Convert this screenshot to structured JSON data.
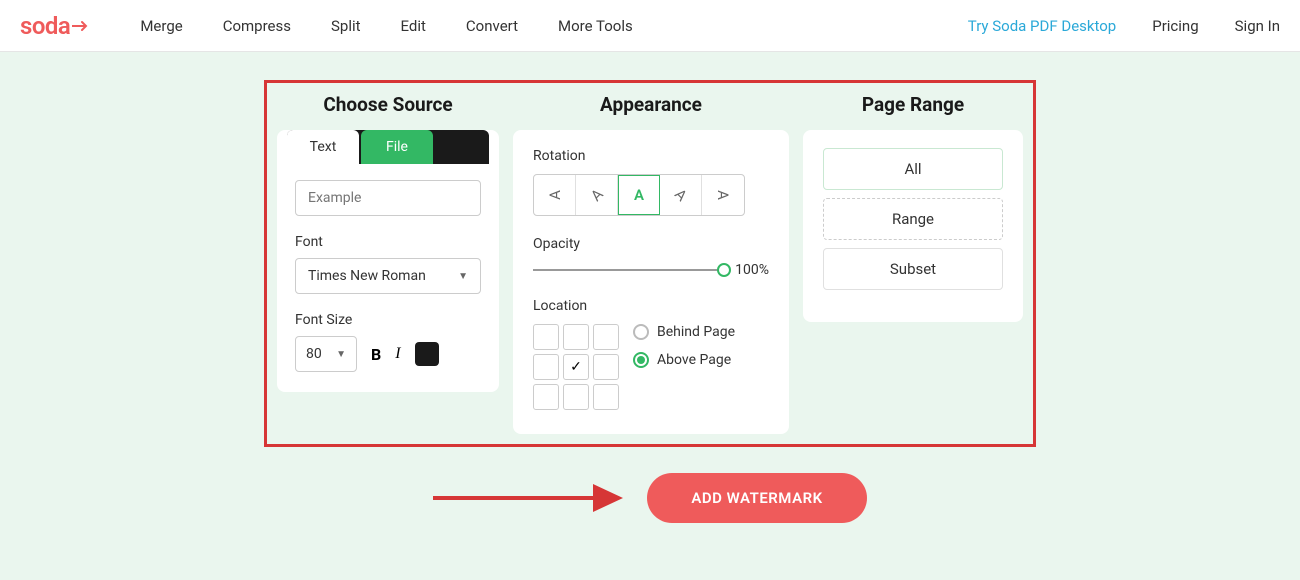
{
  "header": {
    "logo": "soda",
    "nav": [
      "Merge",
      "Compress",
      "Split",
      "Edit",
      "Convert",
      "More Tools"
    ],
    "try_link": "Try Soda PDF Desktop",
    "pricing": "Pricing",
    "signin": "Sign In"
  },
  "source": {
    "title": "Choose Source",
    "tab_text": "Text",
    "tab_file": "File",
    "placeholder": "Example",
    "font_label": "Font",
    "font_value": "Times New Roman",
    "size_label": "Font Size",
    "size_value": "80",
    "bold": "B",
    "italic": "I"
  },
  "appearance": {
    "title": "Appearance",
    "rotation_label": "Rotation",
    "rot_center": "A",
    "opacity_label": "Opacity",
    "opacity_value": "100%",
    "location_label": "Location",
    "check": "✓",
    "behind": "Behind Page",
    "above": "Above Page"
  },
  "range": {
    "title": "Page Range",
    "all": "All",
    "range": "Range",
    "subset": "Subset"
  },
  "cta": "ADD WATERMARK"
}
